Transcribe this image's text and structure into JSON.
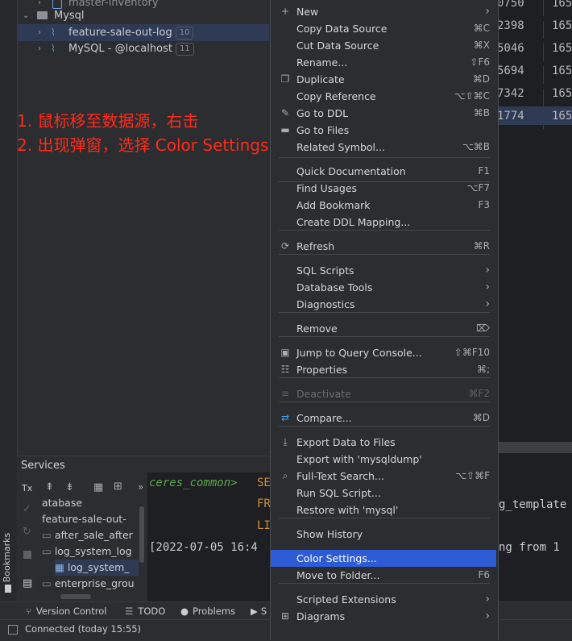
{
  "tree": {
    "partial_top": "master-inventory",
    "group_label": "Mysql",
    "items": [
      {
        "label": "feature-sale-out-log",
        "count": "10"
      },
      {
        "label": "MySQL - @localhost",
        "count": "11"
      }
    ]
  },
  "annotation": {
    "line1": "1. 鼠标移至数据源，右击",
    "line2": "2. 出现弹窗，选择 Color Settings"
  },
  "grid_fragment": {
    "col1": [
      "0750",
      "2398",
      "5046",
      "5694",
      "7342",
      "1774"
    ],
    "col2": [
      "165",
      "165",
      "165",
      "165",
      "165",
      "165"
    ]
  },
  "services": {
    "title": "Services",
    "toolbar": {
      "tx": "Tx"
    },
    "tree_items": [
      "atabase",
      "feature-sale-out-",
      "after_sale_after",
      "log_system_log",
      "log_system_",
      "enterprise_grou"
    ],
    "console_prompt": "ceres_common>",
    "console_keywords": [
      "SE",
      "FR",
      "LI"
    ],
    "console_log": "[2022-07-05 16:4",
    "right_fragment_1": "g_template",
    "right_fragment_2": "ng from 1"
  },
  "side_tab": {
    "label": "Bookmarks"
  },
  "bottom_tabs": [
    "Version Control",
    "TODO",
    "Problems",
    "S"
  ],
  "status": {
    "text": "Connected (today 15:55)"
  },
  "context_menu": {
    "items": [
      {
        "label": "New",
        "shortcut": "",
        "icon": "plus-icon",
        "submenu": true
      },
      {
        "label": "Copy Data Source",
        "shortcut": "⌘C"
      },
      {
        "label": "Cut Data Source",
        "shortcut": "⌘X"
      },
      {
        "label": "Rename...",
        "shortcut": "⇧F6"
      },
      {
        "label": "Duplicate",
        "shortcut": "⌘D",
        "icon": "duplicate-icon"
      },
      {
        "label": "Copy Reference",
        "shortcut": "⌥⇧⌘C"
      },
      {
        "label": "Go to DDL",
        "shortcut": "⌘B",
        "icon": "pencil-icon"
      },
      {
        "label": "Go to Files",
        "shortcut": "",
        "icon": "folder-icon"
      },
      {
        "label": "Related Symbol...",
        "shortcut": "⌥⌘B"
      },
      {
        "label": "Quick Documentation",
        "shortcut": "F1"
      },
      {
        "label": "Find Usages",
        "shortcut": "⌥F7"
      },
      {
        "label": "Add Bookmark",
        "shortcut": "F3"
      },
      {
        "label": "Create DDL Mapping...",
        "shortcut": ""
      },
      {
        "label": "Refresh",
        "shortcut": "⌘R",
        "icon": "refresh-icon"
      },
      {
        "label": "SQL Scripts",
        "shortcut": "",
        "submenu": true
      },
      {
        "label": "Database Tools",
        "shortcut": "",
        "submenu": true
      },
      {
        "label": "Diagnostics",
        "shortcut": "",
        "submenu": true
      },
      {
        "label": "Remove",
        "shortcut": "⌦"
      },
      {
        "label": "Jump to Query Console...",
        "shortcut": "⇧⌘F10",
        "icon": "query-console-icon"
      },
      {
        "label": "Properties",
        "shortcut": "⌘;",
        "icon": "properties-icon"
      },
      {
        "label": "Deactivate",
        "shortcut": "⌘F2",
        "disabled": true,
        "icon": "deactivate-icon"
      },
      {
        "label": "Compare...",
        "shortcut": "⌘D",
        "icon": "compare-icon"
      },
      {
        "label": "Export Data to Files",
        "shortcut": "",
        "icon": "export-icon"
      },
      {
        "label": "Export with 'mysqldump'",
        "shortcut": ""
      },
      {
        "label": "Full-Text Search...",
        "shortcut": "⌥⇧⌘F",
        "icon": "search-icon"
      },
      {
        "label": "Run SQL Script...",
        "shortcut": ""
      },
      {
        "label": "Restore with 'mysql'",
        "shortcut": ""
      },
      {
        "label": "Show History",
        "shortcut": ""
      },
      {
        "label": "Color Settings...",
        "shortcut": "",
        "selected": true
      },
      {
        "label": "Move to Folder...",
        "shortcut": "F6"
      },
      {
        "label": "Scripted Extensions",
        "shortcut": "",
        "submenu": true
      },
      {
        "label": "Diagrams",
        "shortcut": "",
        "submenu": true,
        "icon": "diagram-icon"
      }
    ]
  },
  "colors": {
    "accent_selected": "#2e5cd6",
    "annotation_red": "#ff2a1a",
    "prompt_green": "#58a84a",
    "keyword_orange": "#cf8e3e"
  }
}
